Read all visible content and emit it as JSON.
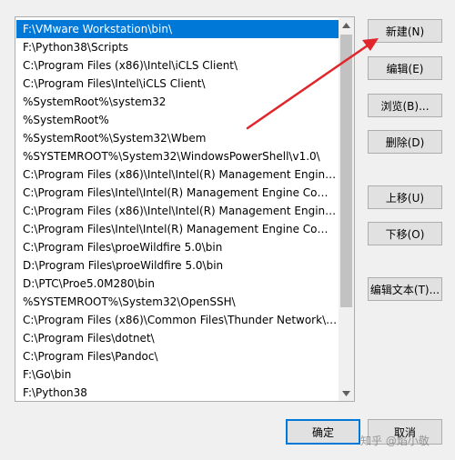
{
  "paths": [
    "F:\\VMware Workstation\\bin\\",
    "F:\\Python38\\Scripts",
    "C:\\Program Files (x86)\\Intel\\iCLS Client\\",
    "C:\\Program Files\\Intel\\iCLS Client\\",
    "%SystemRoot%\\system32",
    "%SystemRoot%",
    "%SystemRoot%\\System32\\Wbem",
    "%SYSTEMROOT%\\System32\\WindowsPowerShell\\v1.0\\",
    "C:\\Program Files (x86)\\Intel\\Intel(R) Management Engine Co...",
    "C:\\Program Files\\Intel\\Intel(R) Management Engine Compon...",
    "C:\\Program Files (x86)\\Intel\\Intel(R) Management Engine Co...",
    "C:\\Program Files\\Intel\\Intel(R) Management Engine Compon...",
    "C:\\Program Files\\proeWildfire 5.0\\bin",
    "D:\\Program Files\\proeWildfire 5.0\\bin",
    "D:\\PTC\\Proe5.0M280\\bin",
    "%SYSTEMROOT%\\System32\\OpenSSH\\",
    "C:\\Program Files (x86)\\Common Files\\Thunder Network\\Kan...",
    "C:\\Program Files\\dotnet\\",
    "C:\\Program Files\\Pandoc\\",
    "F:\\Go\\bin",
    "F:\\Python38"
  ],
  "buttons": {
    "new": "新建(N)",
    "edit": "编辑(E)",
    "browse": "浏览(B)...",
    "delete": "删除(D)",
    "move_up": "上移(U)",
    "move_down": "下移(O)",
    "edit_text": "编辑文本(T)...",
    "ok": "确定",
    "cancel": "取消"
  },
  "watermark": "知乎 @焰小敬",
  "colors": {
    "selection": "#0078d7",
    "annotation_arrow": "#e0262b",
    "dialog_background": "#f0f0f0"
  }
}
